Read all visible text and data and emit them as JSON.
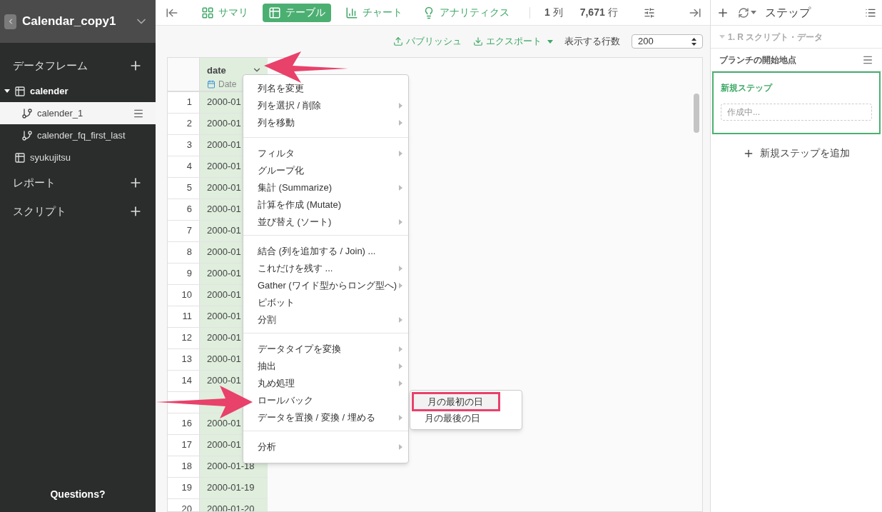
{
  "sidebar": {
    "project_title": "Calendar_copy1",
    "sections": [
      {
        "title": "データフレーム",
        "items": [
          {
            "label": "calender",
            "kind": "table",
            "expanded": true,
            "selected": false,
            "children": [
              {
                "label": "calender_1",
                "kind": "branch",
                "selected": true
              },
              {
                "label": "calender_fq_first_last",
                "kind": "branch",
                "selected": false
              }
            ]
          },
          {
            "label": "syukujitsu",
            "kind": "table",
            "selected": false
          }
        ]
      },
      {
        "title": "レポート"
      },
      {
        "title": "スクリプト"
      }
    ],
    "footer": "Questions?"
  },
  "toolbar": {
    "tabs": [
      {
        "label": "サマリ",
        "selected": false
      },
      {
        "label": "テーブル",
        "selected": true
      },
      {
        "label": "チャート",
        "selected": false
      },
      {
        "label": "アナリティクス",
        "selected": false
      }
    ],
    "counts": [
      {
        "value": "1",
        "unit": "列"
      },
      {
        "value": "7,671",
        "unit": "行"
      }
    ]
  },
  "actions": {
    "publish": "パブリッシュ",
    "export": "エクスポート",
    "rows_label": "表示する行数",
    "rows_value": "200"
  },
  "table": {
    "column": {
      "name": "date",
      "type": "Date"
    },
    "rows": [
      {
        "number": "1",
        "date": "2000-01"
      },
      {
        "number": "2",
        "date": "2000-01"
      },
      {
        "number": "3",
        "date": "2000-01"
      },
      {
        "number": "4",
        "date": "2000-01"
      },
      {
        "number": "5",
        "date": "2000-01"
      },
      {
        "number": "6",
        "date": "2000-01"
      },
      {
        "number": "7",
        "date": "2000-01"
      },
      {
        "number": "8",
        "date": "2000-01"
      },
      {
        "number": "9",
        "date": "2000-01"
      },
      {
        "number": "10",
        "date": "2000-01"
      },
      {
        "number": "11",
        "date": "2000-01"
      },
      {
        "number": "12",
        "date": "2000-01"
      },
      {
        "number": "13",
        "date": "2000-01"
      },
      {
        "number": "14",
        "date": "2000-01"
      },
      {
        "kind": "covered"
      },
      {
        "number": "16",
        "date": "2000-01"
      },
      {
        "number": "17",
        "date": "2000-01"
      },
      {
        "number": "18",
        "date": "2000-01-18"
      },
      {
        "number": "19",
        "date": "2000-01-19"
      },
      {
        "number": "20",
        "date": "2000-01-20"
      }
    ]
  },
  "column_menu": {
    "groups": [
      [
        {
          "label": "列名を変更",
          "submenu": false
        },
        {
          "label": "列を選択 / 削除",
          "submenu": true
        },
        {
          "label": "列を移動",
          "submenu": true
        }
      ],
      [
        {
          "label": "フィルタ",
          "submenu": true
        },
        {
          "label": "グループ化",
          "submenu": false
        },
        {
          "label": "集計 (Summarize)",
          "submenu": true
        },
        {
          "label": "計算を作成 (Mutate)",
          "submenu": false
        },
        {
          "label": "並び替え (ソート)",
          "submenu": true
        }
      ],
      [
        {
          "label": "結合 (列を追加する / Join) ...",
          "submenu": false
        },
        {
          "label": "これだけを残す ...",
          "submenu": true
        },
        {
          "label": "Gather (ワイド型からロング型へ)",
          "submenu": true
        },
        {
          "label": "ピボット",
          "submenu": false
        },
        {
          "label": "分割",
          "submenu": true
        }
      ],
      [
        {
          "label": "データタイプを変換",
          "submenu": true
        },
        {
          "label": "抽出",
          "submenu": true
        },
        {
          "label": "丸め処理",
          "submenu": true
        },
        {
          "label": "ロールバック",
          "submenu": false
        },
        {
          "label": "データを置換 / 変換 / 埋める",
          "submenu": true
        }
      ],
      [
        {
          "label": "分析",
          "submenu": true
        }
      ]
    ],
    "submenu": [
      {
        "label": "月の最初の日",
        "selected": true
      },
      {
        "label": "月の最後の日",
        "selected": false
      }
    ]
  },
  "steps": {
    "title": "ステップ",
    "source": "1. R スクリプト・データ",
    "branch_start": "ブランチの開始地点",
    "new_step": {
      "title": "新規ステップ",
      "placeholder": "作成中..."
    },
    "add": "新規ステップを追加"
  }
}
